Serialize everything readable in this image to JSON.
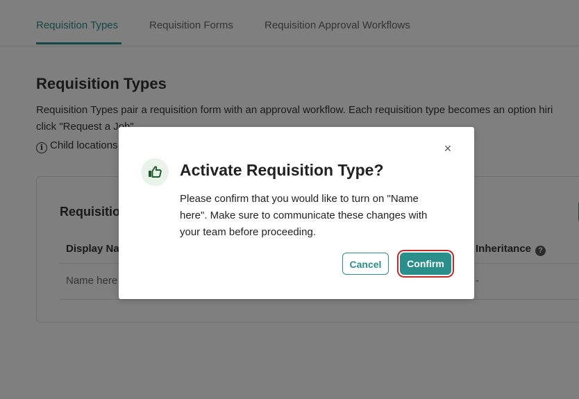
{
  "tabs": [
    {
      "label": "Requisition Types"
    },
    {
      "label": "Requisition Forms"
    },
    {
      "label": "Requisition Approval Workflows"
    }
  ],
  "page": {
    "title": "Requisition Types",
    "description_line1": "Requisition Types pair a requisition form with an approval workflow. Each requisition type becomes an option hiri",
    "description_line2": "click \"Request a Job\".",
    "info_text": "Child locations"
  },
  "card": {
    "title": "Requisitio",
    "columns": {
      "display_name": "Display Na",
      "inheritance": "Inheritance"
    },
    "rows": [
      {
        "display_name": "Name here",
        "inheritance": "-"
      }
    ]
  },
  "modal": {
    "title": "Activate Requisition Type?",
    "body": "Please confirm that you would like to turn on \"Name here\". Make sure to communicate these changes with your team before proceeding.",
    "cancel_label": "Cancel",
    "confirm_label": "Confirm",
    "close_glyph": "×"
  },
  "colors": {
    "accent": "#2a8f8a",
    "focus_ring": "#c62828",
    "icon_bg": "#e9f3ea"
  }
}
